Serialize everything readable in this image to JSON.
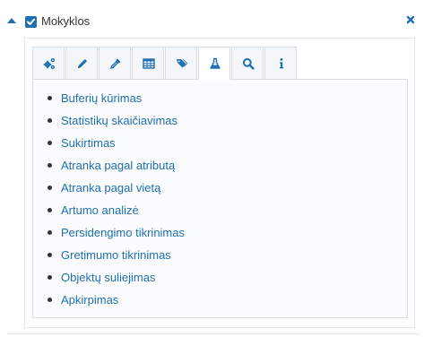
{
  "layer": {
    "title": "Mokyklos",
    "checked": true
  },
  "tabs": [
    {
      "icon": "gears-icon",
      "active": false
    },
    {
      "icon": "pencil-icon",
      "active": false
    },
    {
      "icon": "eyedropper-icon",
      "active": false
    },
    {
      "icon": "table-icon",
      "active": false
    },
    {
      "icon": "tags-icon",
      "active": false
    },
    {
      "icon": "flask-icon",
      "active": true
    },
    {
      "icon": "search-icon",
      "active": false
    },
    {
      "icon": "info-icon",
      "active": false
    }
  ],
  "tools": [
    "Buferių kūrimas",
    "Statistikų skaičiavimas",
    "Sukirtimas",
    "Atranka pagal atributą",
    "Atranka pagal vietą",
    "Artumo analizė",
    "Persidengimo tikrinimas",
    "Gretimumo tikrinimas",
    "Objektų suliejimas",
    "Apkirpimas"
  ],
  "colors": {
    "accent": "#1f6fb2",
    "text": "#333333",
    "border": "#d7dfe5",
    "tab_bg": "#f4f7f9"
  }
}
